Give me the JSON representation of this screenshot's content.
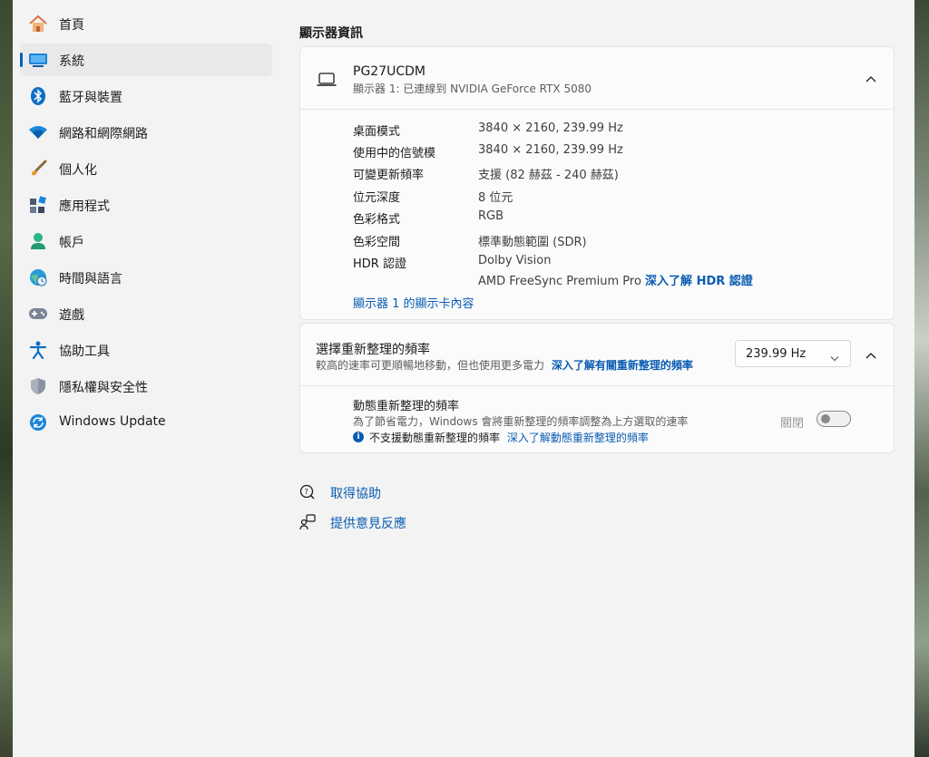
{
  "sidebar": {
    "items": [
      {
        "label": "首頁",
        "icon": "home-icon"
      },
      {
        "label": "系統",
        "icon": "system-display-icon",
        "active": true
      },
      {
        "label": "藍牙與裝置",
        "icon": "bluetooth-icon"
      },
      {
        "label": "網路和網際網路",
        "icon": "wifi-icon"
      },
      {
        "label": "個人化",
        "icon": "brush-icon"
      },
      {
        "label": "應用程式",
        "icon": "apps-icon"
      },
      {
        "label": "帳戶",
        "icon": "account-icon"
      },
      {
        "label": "時間與語言",
        "icon": "globe-clock-icon"
      },
      {
        "label": "遊戲",
        "icon": "gamepad-icon"
      },
      {
        "label": "協助工具",
        "icon": "accessibility-icon"
      },
      {
        "label": "隱私權與安全性",
        "icon": "shield-icon"
      },
      {
        "label": "Windows Update",
        "icon": "windows-update-icon"
      }
    ]
  },
  "main": {
    "section_title": "顯示器資訊",
    "monitor": {
      "name": "PG27UCDM",
      "subtitle": "顯示器 1: 已連線到 NVIDIA GeForce RTX 5080",
      "rows": [
        {
          "label": "桌面模式",
          "value": "3840 × 2160, 239.99 Hz"
        },
        {
          "label": "使用中的信號模",
          "value": "3840 × 2160, 239.99 Hz"
        },
        {
          "label": "可變更新頻率",
          "value": "支援 (82 赫茲 - 240 赫茲)"
        },
        {
          "label": "位元深度",
          "value": "8 位元"
        },
        {
          "label": "色彩格式",
          "value": "RGB"
        },
        {
          "label": "色彩空間",
          "value": "標準動態範圍 (SDR)"
        },
        {
          "label": "HDR 認證",
          "value": "Dolby Vision"
        }
      ],
      "hdr_value_2": "AMD FreeSync Premium Pro",
      "hdr_link": "深入了解 HDR 認證",
      "adapter_link": "顯示器 1 的顯示卡內容"
    },
    "refresh": {
      "title": "選擇重新整理的頻率",
      "desc": "較高的速率可更順暢地移動，但也使用更多電力",
      "link": "深入了解有關重新整理的頻率",
      "selected": "239.99 Hz"
    },
    "dynamic": {
      "title": "動態重新整理的頻率",
      "desc": "為了節省電力，Windows 會將重新整理的頻率調整為上方選取的速率",
      "toggle_label": "關閉",
      "toggle_on": false,
      "notice": "不支援動態重新整理的頻率",
      "notice_link": "深入了解動態重新整理的頻率"
    },
    "help": {
      "get_help": "取得協助",
      "feedback": "提供意見反應"
    }
  },
  "colors": {
    "accent": "#005fb8",
    "link": "#0a5cb2"
  }
}
